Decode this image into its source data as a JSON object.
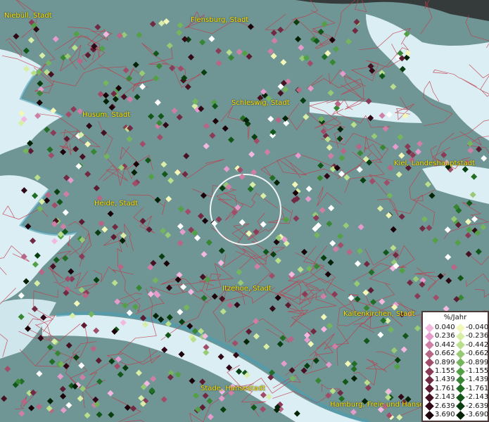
{
  "legend": {
    "title": "%/Jahr",
    "positive": [
      {
        "value": "0.040",
        "color": "#f4b8e0"
      },
      {
        "value": "0.236",
        "color": "#e59bcc"
      },
      {
        "value": "0.442",
        "color": "#cf7fa6"
      },
      {
        "value": "0.662",
        "color": "#b86685"
      },
      {
        "value": "0.899",
        "color": "#a14d6a"
      },
      {
        "value": "1.155",
        "color": "#8a3b55"
      },
      {
        "value": "1.439",
        "color": "#722a42"
      },
      {
        "value": "1.761",
        "color": "#5c1c31"
      },
      {
        "value": "2.143",
        "color": "#461222"
      },
      {
        "value": "2.639",
        "color": "#310816"
      },
      {
        "value": "3.690",
        "color": "#1a0208"
      }
    ],
    "negative": [
      {
        "value": "-0.040",
        "color": "#f3f7b8"
      },
      {
        "value": "-0.236",
        "color": "#d8eda6"
      },
      {
        "value": "-0.442",
        "color": "#b9de8c"
      },
      {
        "value": "-0.662",
        "color": "#98c976"
      },
      {
        "value": "-0.899",
        "color": "#75b55e"
      },
      {
        "value": "-1.155",
        "color": "#53a047"
      },
      {
        "value": "-1.439",
        "color": "#388634"
      },
      {
        "value": "-1.761",
        "color": "#226e26"
      },
      {
        "value": "-2.143",
        "color": "#13561a"
      },
      {
        "value": "-2.639",
        "color": "#093e10"
      },
      {
        "value": "-3.690",
        "color": "#032206"
      }
    ]
  },
  "cities": [
    {
      "name": "Niebüll, Stadt"
    },
    {
      "name": "Flensburg, Stadt"
    },
    {
      "name": "Husum, Stadt"
    },
    {
      "name": "Schleswig, Stadt"
    },
    {
      "name": "Kiel, Landeshauptstadt"
    },
    {
      "name": "Heide, Stadt"
    },
    {
      "name": "Itzehoe, Stadt"
    },
    {
      "name": "Kaltenkirchen, Stadt"
    },
    {
      "name": "Stade, Hansestadt"
    },
    {
      "name": "Hamburg, Freie und Hansestadt"
    }
  ],
  "colors": {
    "land": "#6f9695",
    "water": "#dbeef3",
    "shallow": "#4f9db0",
    "borders": "#c23a4a",
    "label": "#ffe100",
    "focus_ring": "#ffffff",
    "zero_dot": "#ffffff"
  }
}
